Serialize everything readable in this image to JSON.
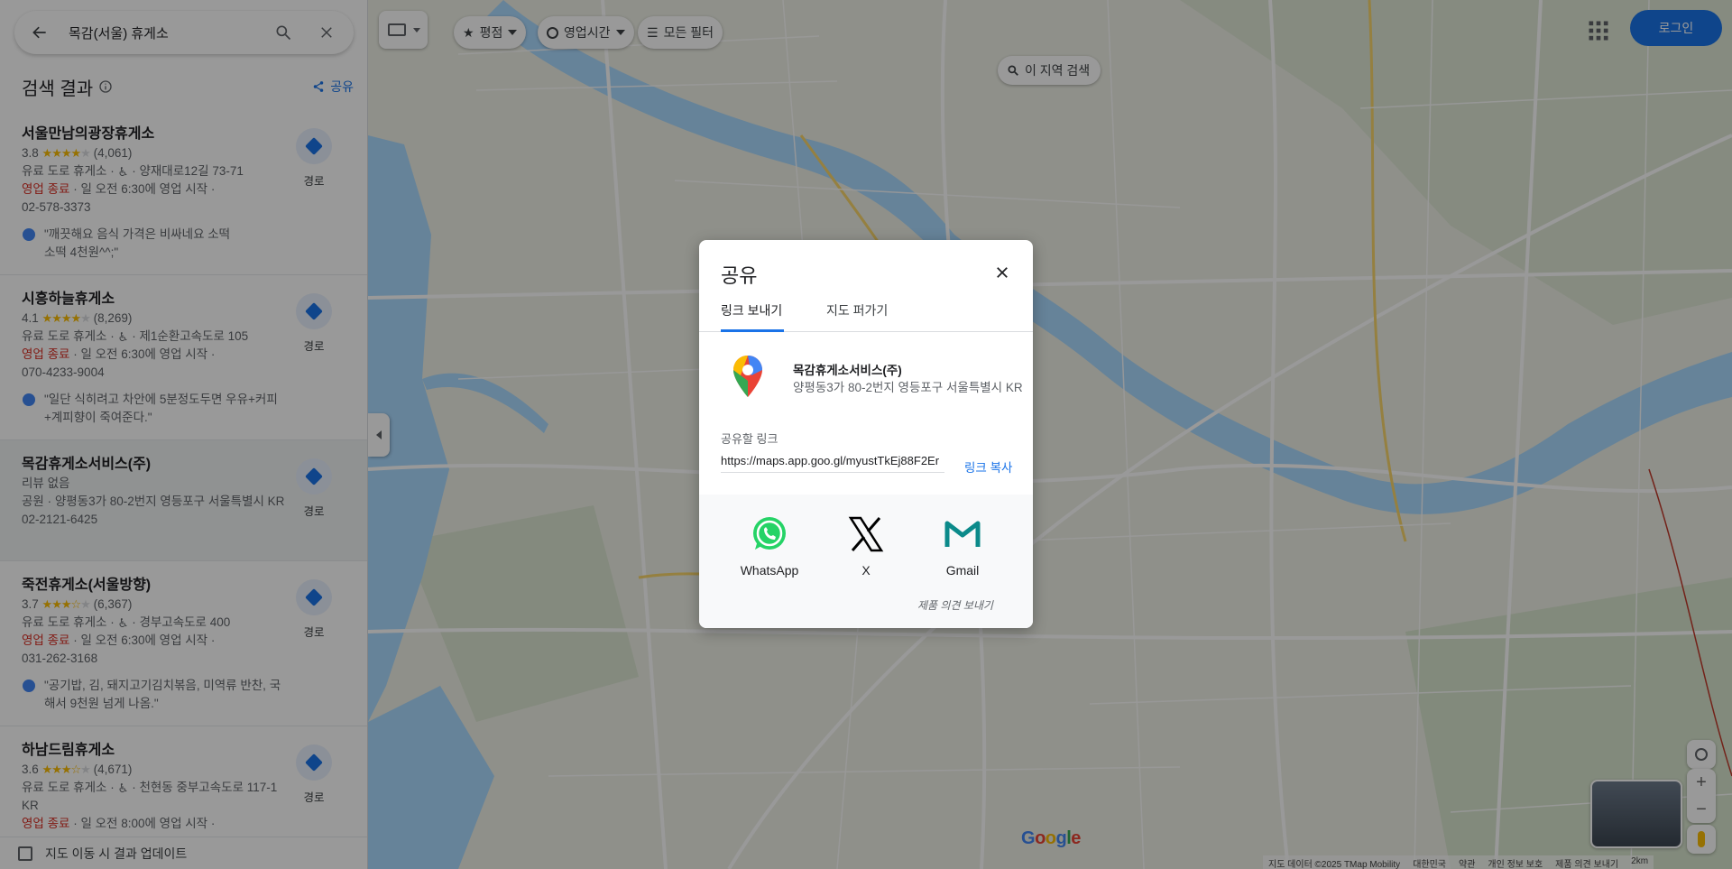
{
  "search": {
    "query": "목감(서울) 휴게소"
  },
  "results_header": {
    "title": "검색 결과",
    "share_label": "공유"
  },
  "results": [
    {
      "name": "서울만남의광장휴게소",
      "rating": "3.8",
      "stars_filled": 4,
      "reviews": "(4,061)",
      "category": "유료 도로 휴게소",
      "address": "양재대로12길 73-71",
      "status": "영업 종료",
      "hours": "일 오전 6:30에 영업 시작",
      "phone": "02-578-3373",
      "review_text": "\"깨끗해요 음식 가격은 비싸네요 소떡소떡 4천원^^;\"",
      "dir_label": "경로"
    },
    {
      "name": "시흥하늘휴게소",
      "rating": "4.1",
      "stars_filled": 4,
      "reviews": "(8,269)",
      "category": "유료 도로 휴게소",
      "address": "제1순환고속도로 105",
      "status": "영업 종료",
      "hours": "일 오전 6:30에 영업 시작",
      "phone": "070-4233-9004",
      "review_text": "\"일단 식히려고 차안에 5분정도두면 우유+커피+계피향이 죽여준다.\"",
      "dir_label": "경로"
    },
    {
      "name": "목감휴게소서비스(주)",
      "no_review": "리뷰 없음",
      "category": "공원",
      "address": "양평동3가 80-2번지 영등포구 서울특별시 KR",
      "phone": "02-2121-6425",
      "dir_label": "경로"
    },
    {
      "name": "죽전휴게소(서울방향)",
      "rating": "3.7",
      "stars_filled": 3.5,
      "reviews": "(6,367)",
      "category": "유료 도로 휴게소",
      "address": "경부고속도로 400",
      "status": "영업 종료",
      "hours": "일 오전 6:30에 영업 시작",
      "phone": "031-262-3168",
      "review_text": "\"공기밥, 김, 돼지고기김치볶음, 미역류 반찬, 국 해서 9천원 넘게 나옴.\"",
      "dir_label": "경로"
    },
    {
      "name": "하남드림휴게소",
      "rating": "3.6",
      "stars_filled": 3.5,
      "reviews": "(4,671)",
      "category": "유료 도로 휴게소",
      "address": "천현동 중부고속도로 117-1 KR",
      "status": "영업 종료",
      "hours": "일 오전 8:00에 영업 시작",
      "dir_label": "경로"
    }
  ],
  "update_bar": {
    "label": "지도 이동 시 결과 업데이트"
  },
  "filters": {
    "rating": "평점",
    "hours": "영업시간",
    "all": "모든 필터"
  },
  "area_search": "이 지역 검색",
  "login": "로그인",
  "map_footer": {
    "items": [
      "지도 데이터 ©2025 TMap Mobility",
      "대한민국",
      "약관",
      "개인 정보 보호",
      "제품 의견 보내기",
      "2km"
    ],
    "google": "Google"
  },
  "zoom": {
    "in": "+",
    "out": "−"
  },
  "dialog": {
    "title": "공유",
    "tabs": [
      "링크 보내기",
      "지도 퍼가기"
    ],
    "place_name": "목감휴게소서비스(주)",
    "place_address": "양평동3가 80-2번지 영등포구 서울특별시 KR",
    "link_label": "공유할 링크",
    "link_value": "https://maps.app.goo.gl/myustTkEj88F2Er",
    "copy_label": "링크 복사",
    "share_options": [
      "WhatsApp",
      "X",
      "Gmail"
    ],
    "feedback": "제품 의견 보내기"
  },
  "colors": {
    "accent": "#1a73e8",
    "closed": "#d93025",
    "star": "#fbbc04",
    "whatsapp": "#25d366",
    "gmail_teal": "#0b8a8a"
  }
}
